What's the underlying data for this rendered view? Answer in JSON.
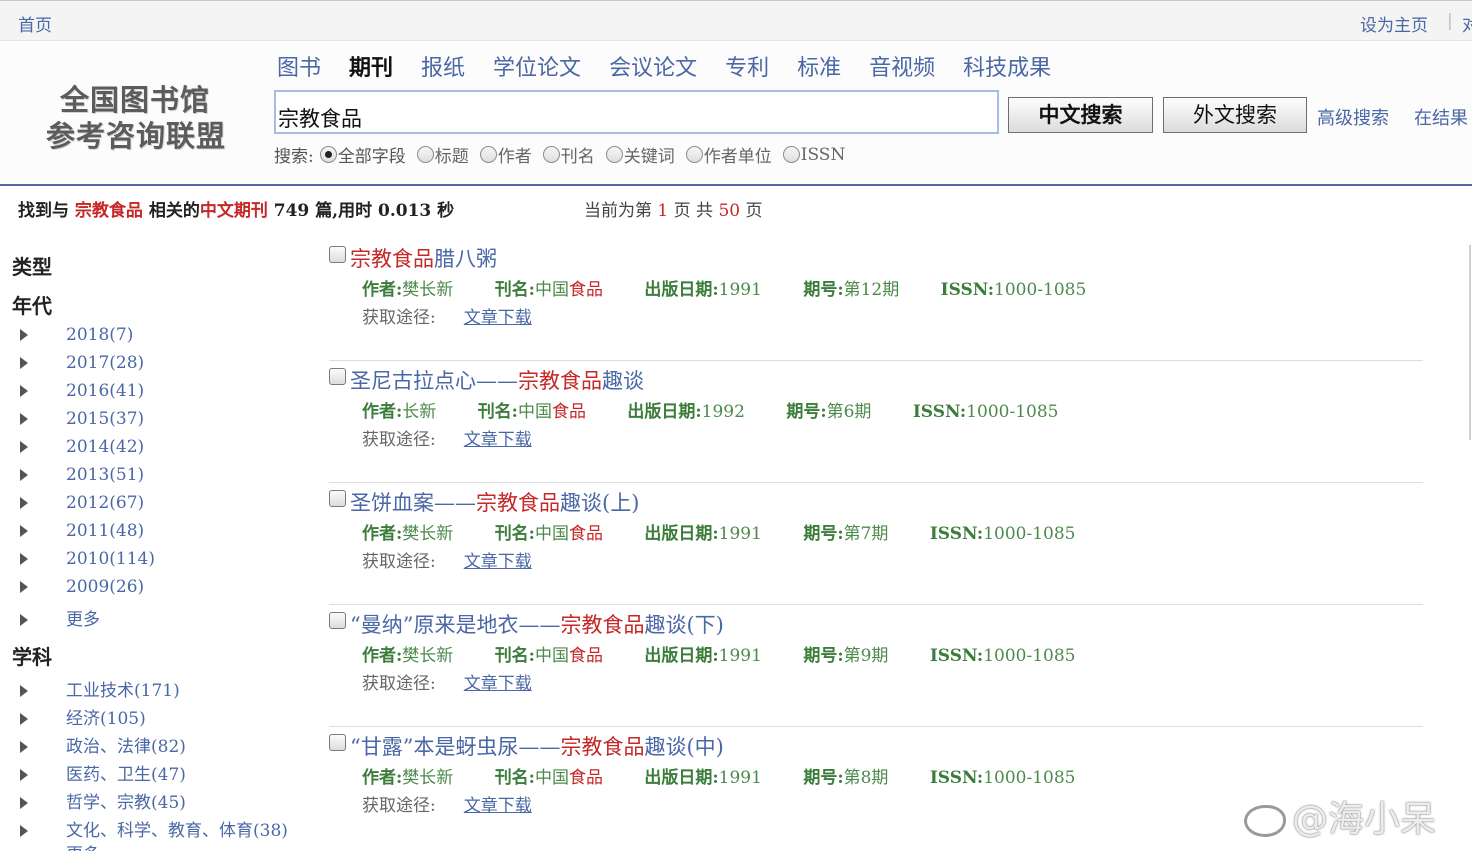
{
  "topbar": {
    "home": "首页",
    "set_home": "设为主页",
    "sep": "|",
    "cut": "对"
  },
  "logo": {
    "line1": "全国图书馆",
    "line2": "参考咨询联盟"
  },
  "nav": {
    "tabs": [
      {
        "label": "图书"
      },
      {
        "label": "期刊"
      },
      {
        "label": "报纸"
      },
      {
        "label": "学位论文"
      },
      {
        "label": "会议论文"
      },
      {
        "label": "专利"
      },
      {
        "label": "标准"
      },
      {
        "label": "音视频"
      },
      {
        "label": "科技成果"
      }
    ],
    "active": "期刊"
  },
  "search": {
    "query": "宗教食品",
    "btn_cn": "中文搜索",
    "btn_foreign": "外文搜索",
    "advanced": "高级搜索",
    "in_results": "在结果",
    "scope_label": "搜索:",
    "options": [
      "全部字段",
      "标题",
      "作者",
      "刊名",
      "关键词",
      "作者单位",
      "ISSN"
    ],
    "selected": "全部字段"
  },
  "summary": {
    "found": "找到与",
    "query": "宗教食品",
    "related": "相关的",
    "type": "中文期刊",
    "count": "749",
    "tail": "篇,用时 0.013 秒",
    "page_prefix": "当前为第",
    "page_current": "1",
    "page_mid": "页 共",
    "page_total": "50",
    "page_suffix": "页"
  },
  "sidebar": {
    "type_heading": "类型",
    "year_heading": "年代",
    "years": [
      {
        "label": "2018(7)"
      },
      {
        "label": "2017(28)"
      },
      {
        "label": "2016(41)"
      },
      {
        "label": "2015(37)"
      },
      {
        "label": "2014(42)"
      },
      {
        "label": "2013(51)"
      },
      {
        "label": "2012(67)"
      },
      {
        "label": "2011(48)"
      },
      {
        "label": "2010(114)"
      },
      {
        "label": "2009(26)"
      },
      {
        "label": "更多"
      }
    ],
    "subject_heading": "学科",
    "subjects": [
      {
        "label": "工业技术(171)"
      },
      {
        "label": "经济(105)"
      },
      {
        "label": "政治、法律(82)"
      },
      {
        "label": "医药、卫生(47)"
      },
      {
        "label": "哲学、宗教(45)"
      },
      {
        "label": "文化、科学、教育、体育(38)"
      },
      {
        "label": "更多"
      }
    ]
  },
  "labels": {
    "author": "作者:",
    "journal": "刊名:",
    "date": "出版日期:",
    "issue": "期号:",
    "issn": "ISSN:",
    "access": "获取途径:",
    "download": "文章下载",
    "journal_pre": "中国",
    "journal_hl": "食品"
  },
  "results": [
    {
      "title_pre": "",
      "title_hl": "宗教食品",
      "title_post": "腊八粥",
      "author": "樊长新",
      "date": "1991",
      "issue": "第12期",
      "issn": "1000-1085"
    },
    {
      "title_pre": "圣尼古拉点心——",
      "title_hl": "宗教食品",
      "title_post": "趣谈",
      "author": "长新",
      "date": "1992",
      "issue": "第6期",
      "issn": "1000-1085"
    },
    {
      "title_pre": "圣饼血案——",
      "title_hl": "宗教食品",
      "title_post": "趣谈(上)",
      "author": "樊长新",
      "date": "1991",
      "issue": "第7期",
      "issn": "1000-1085"
    },
    {
      "title_pre": "“曼纳”原来是地衣——",
      "title_hl": "宗教食品",
      "title_post": "趣谈(下)",
      "author": "樊长新",
      "date": "1991",
      "issue": "第9期",
      "issn": "1000-1085"
    },
    {
      "title_pre": "“甘露”本是蚜虫尿——",
      "title_hl": "宗教食品",
      "title_post": "趣谈(中)",
      "author": "樊长新",
      "date": "1991",
      "issue": "第8期",
      "issn": "1000-1085"
    }
  ],
  "watermark": "@海小呆"
}
